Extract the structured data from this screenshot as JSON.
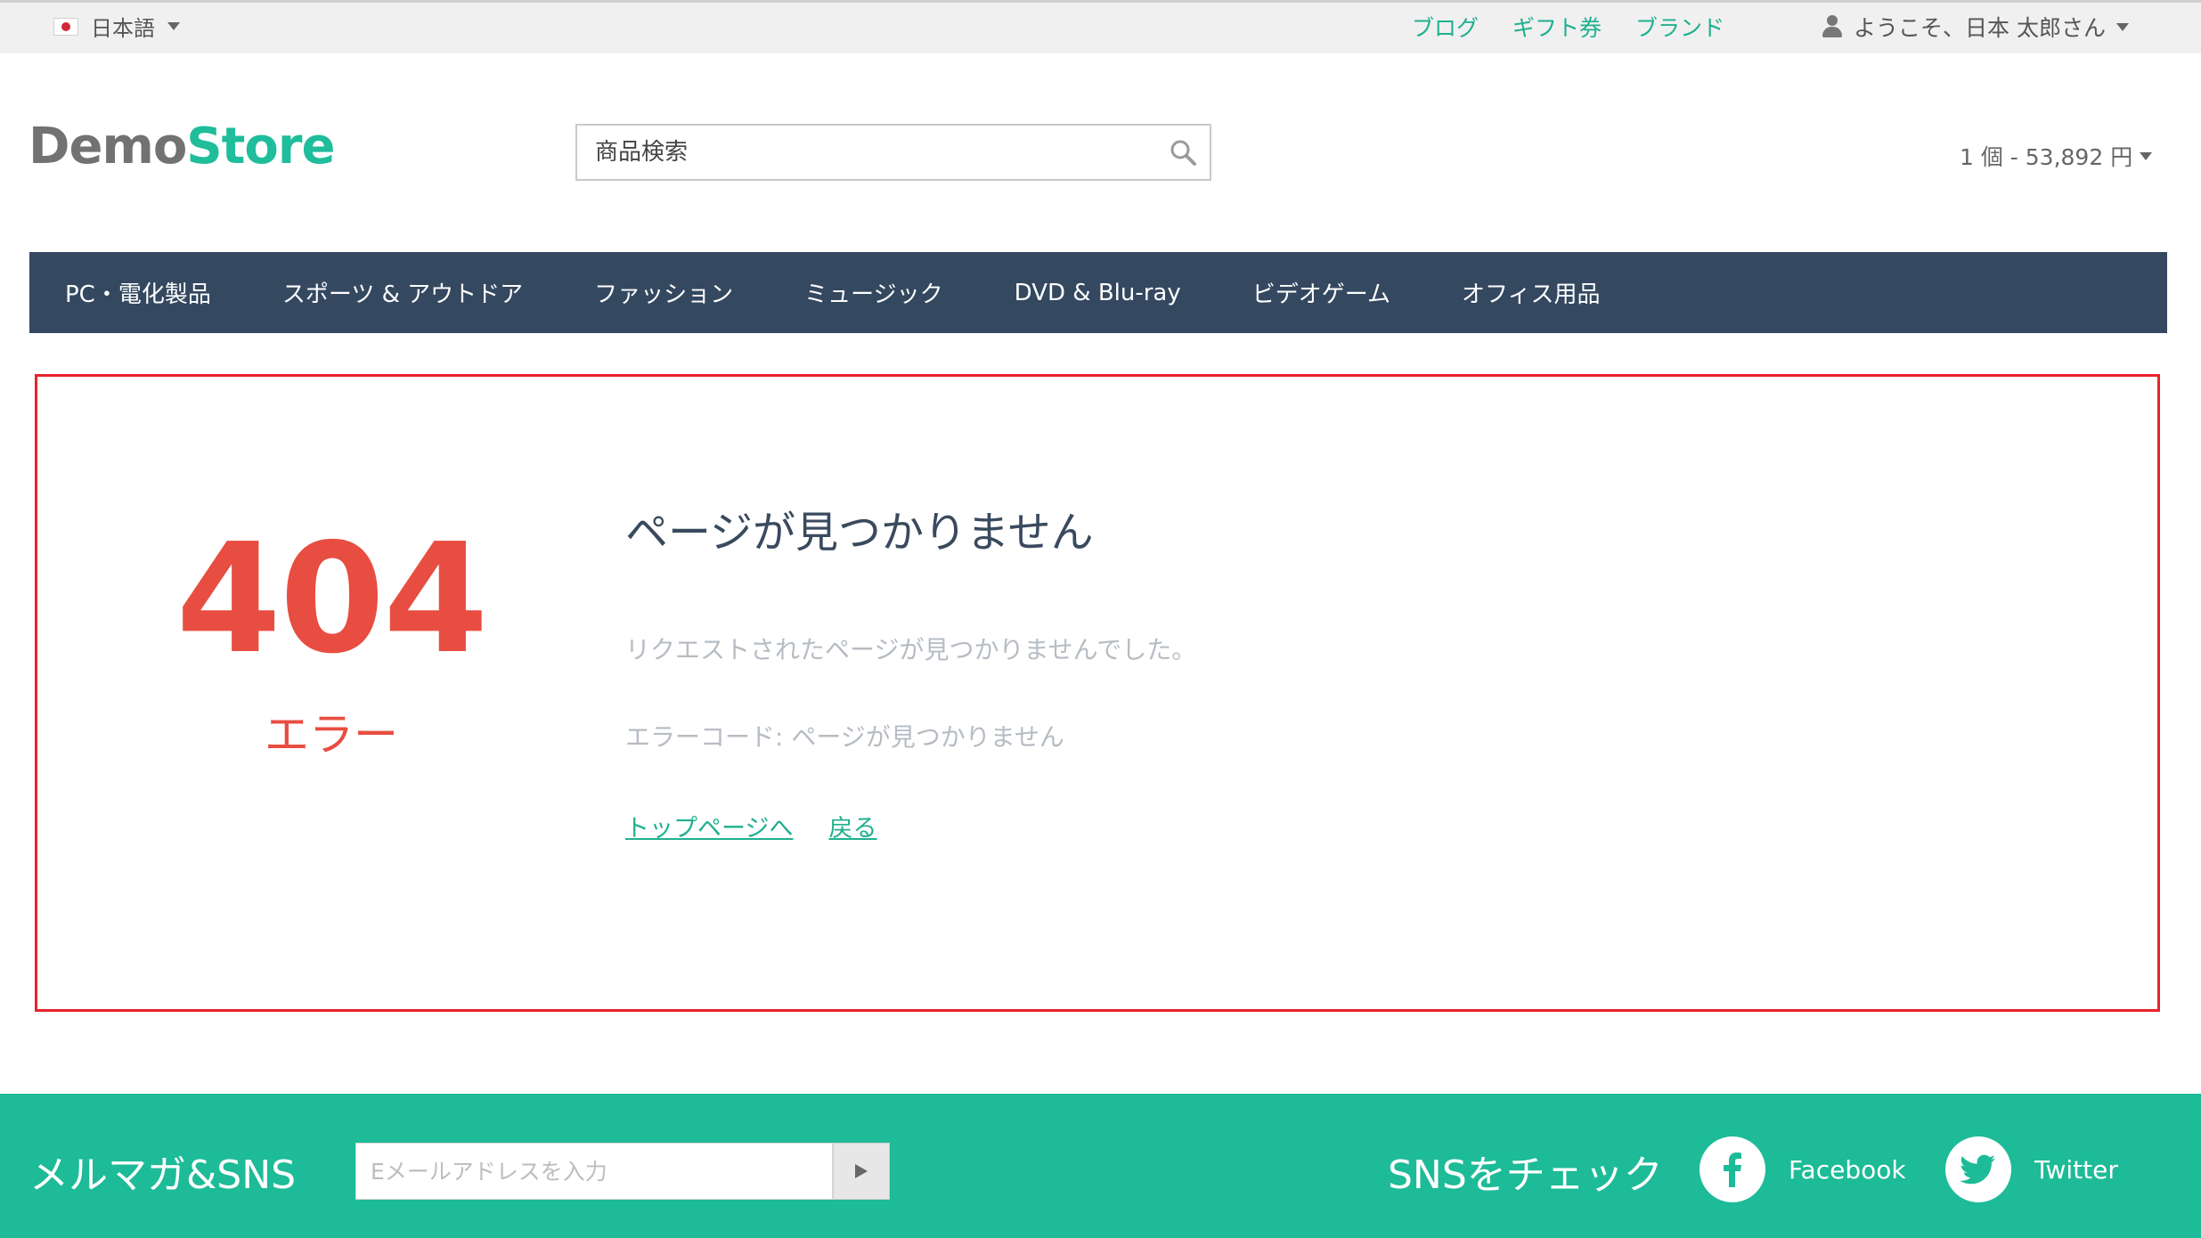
{
  "topbar": {
    "language": "日本語",
    "links": [
      "ブログ",
      "ギフト券",
      "ブランド"
    ],
    "welcome": "ようこそ、日本 太郎さん"
  },
  "header": {
    "logo_part1": "Demo",
    "logo_part2": "Store",
    "search_placeholder": "商品検索",
    "cart_summary": "1 個 - 53,892 円"
  },
  "nav": {
    "categories": [
      "PC・電化製品",
      "スポーツ & アウトドア",
      "ファッション",
      "ミュージック",
      "DVD & Blu-ray",
      "ビデオゲーム",
      "オフィス用品"
    ]
  },
  "error": {
    "code": "404",
    "label": "エラー",
    "title": "ページが見つかりません",
    "message": "リクエストされたページが見つかりませんでした。",
    "detail": "エラーコード: ページが見つかりません",
    "links": [
      "トップページへ",
      "戻る"
    ]
  },
  "footer": {
    "newsletter_title": "メルマガ&SNS",
    "email_placeholder": "Eメールアドレスを入力",
    "sns_title": "SNSをチェック",
    "facebook": "Facebook",
    "twitter": "Twitter"
  },
  "colors": {
    "accent": "#1fbd9b",
    "nav_bg": "#344860",
    "error_red": "#e84d41",
    "footer_bg": "#1dbb97"
  },
  "icons": [
    "flag-japan-icon",
    "chevron-down-icon",
    "user-icon",
    "search-icon",
    "play-icon",
    "facebook-icon",
    "twitter-icon"
  ]
}
